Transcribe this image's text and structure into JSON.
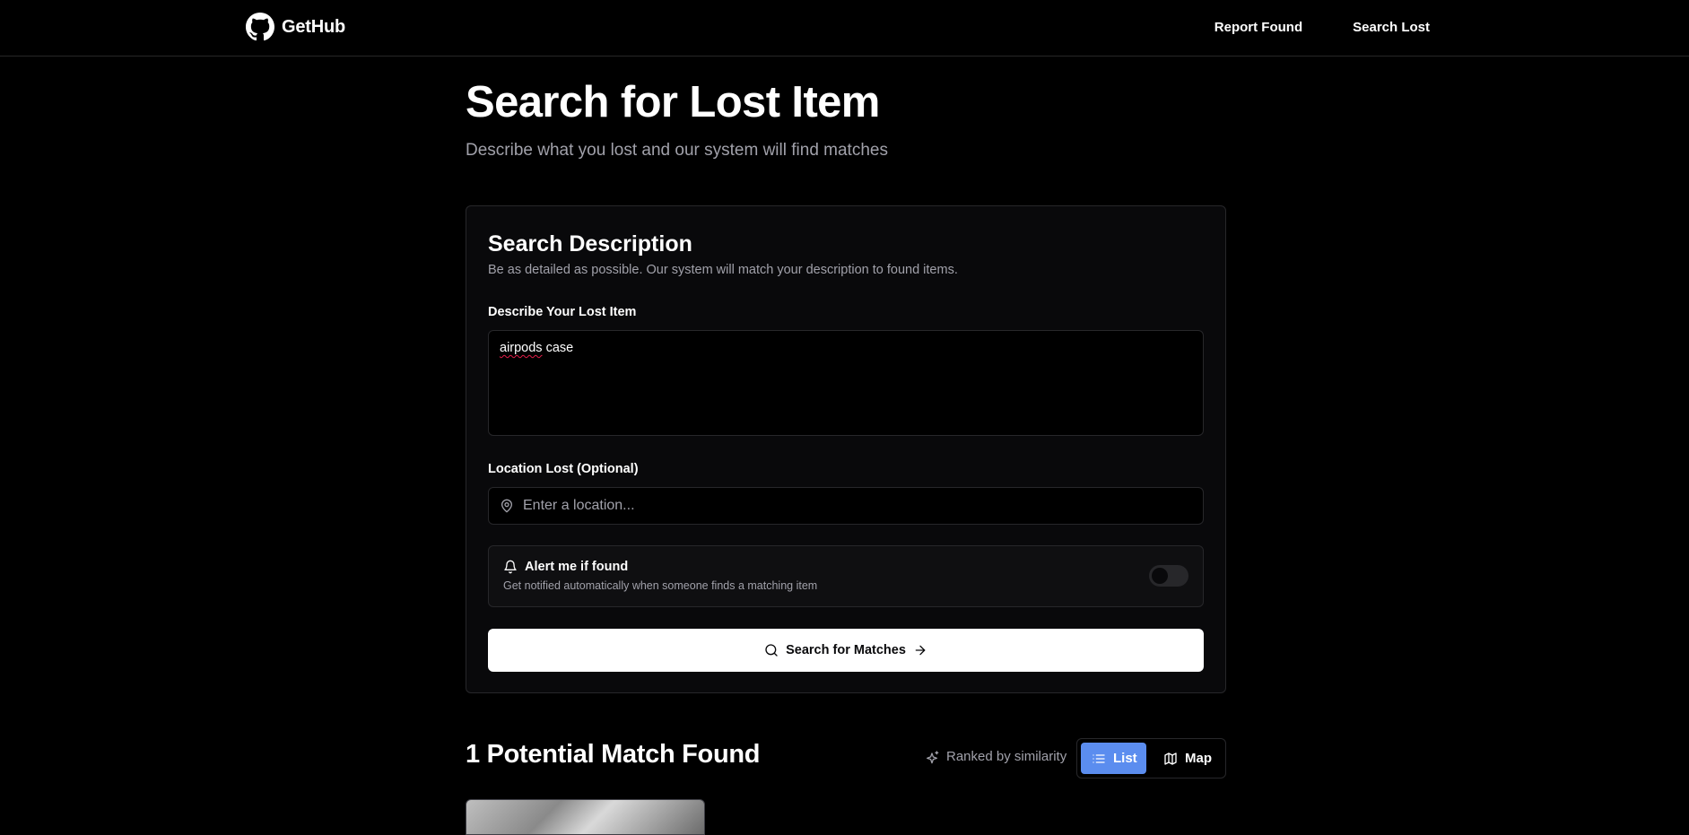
{
  "nav": {
    "brand": "GetHub",
    "links": [
      "Report Found",
      "Search Lost"
    ]
  },
  "page": {
    "title": "Search for Lost Item",
    "subtitle": "Describe what you lost and our system will find matches"
  },
  "form": {
    "card_title": "Search Description",
    "card_desc": "Be as detailed as possible. Our system will match your description to found items.",
    "desc_label": "Describe Your Lost Item",
    "desc_value_word1": "airpods",
    "desc_value_rest": " case",
    "location_label": "Location Lost (Optional)",
    "location_placeholder": "Enter a location...",
    "alert_title": "Alert me if found",
    "alert_desc": "Get notified automatically when someone finds a matching item",
    "alert_enabled": false,
    "search_button": "Search for Matches"
  },
  "results": {
    "title": "1 Potential Match Found",
    "rank_note": "Ranked by similarity",
    "view_list": "List",
    "view_map": "Map",
    "active_view": "List"
  },
  "colors": {
    "accent": "#5b8def",
    "background": "#000000",
    "card": "#09090b",
    "border": "#27272a",
    "muted_text": "#a1a1aa"
  },
  "icons": [
    "github-logo",
    "map-pin-icon",
    "bell-icon",
    "search-icon",
    "arrow-right-icon",
    "sparkles-icon",
    "list-icon",
    "map-icon"
  ]
}
